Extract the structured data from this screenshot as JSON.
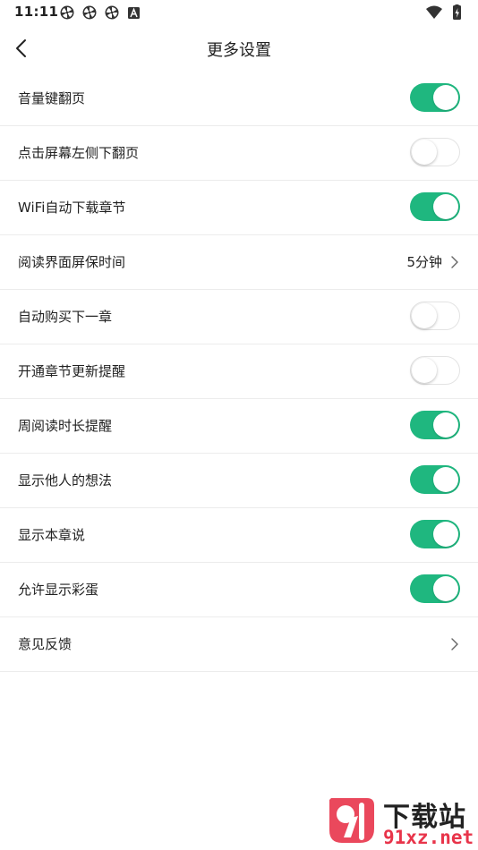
{
  "status_bar": {
    "time": "11:11",
    "notification_icons": [
      "pinwheel-icon",
      "pinwheel-icon",
      "pinwheel-icon",
      "a-letter-icon"
    ],
    "right_icons": [
      "wifi-icon",
      "battery-charging-icon"
    ]
  },
  "header": {
    "back_icon": "chevron-left-icon",
    "title": "更多设置"
  },
  "settings": [
    {
      "label": "音量键翻页",
      "type": "toggle",
      "state": "on"
    },
    {
      "label": "点击屏幕左侧下翻页",
      "type": "toggle",
      "state": "off"
    },
    {
      "label": "WiFi自动下载章节",
      "type": "toggle",
      "state": "on"
    },
    {
      "label": "阅读界面屏保时间",
      "type": "value",
      "value": "5分钟"
    },
    {
      "label": "自动购买下一章",
      "type": "toggle",
      "state": "off"
    },
    {
      "label": "开通章节更新提醒",
      "type": "toggle",
      "state": "off"
    },
    {
      "label": "周阅读时长提醒",
      "type": "toggle",
      "state": "on"
    },
    {
      "label": "显示他人的想法",
      "type": "toggle",
      "state": "on"
    },
    {
      "label": "显示本章说",
      "type": "toggle",
      "state": "on"
    },
    {
      "label": "允许显示彩蛋",
      "type": "toggle",
      "state": "on"
    },
    {
      "label": "意见反馈",
      "type": "link"
    }
  ],
  "colors": {
    "toggle_on": "#1fb77f",
    "toggle_off_border": "#e3e3e3",
    "divider": "#ececec",
    "watermark_red": "#e8344a"
  },
  "watermark": {
    "main": "下载站",
    "sub": "91xz.net"
  }
}
